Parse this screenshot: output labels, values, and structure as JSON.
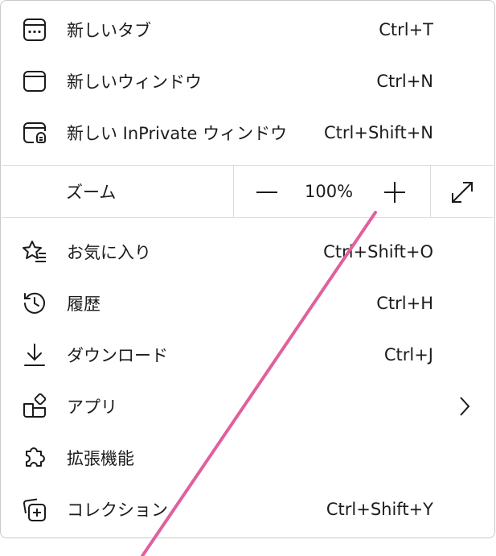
{
  "menu": {
    "items_top": [
      {
        "label": "新しいタブ",
        "shortcut": "Ctrl+T",
        "icon": "new-tab-icon"
      },
      {
        "label": "新しいウィンドウ",
        "shortcut": "Ctrl+N",
        "icon": "new-window-icon"
      },
      {
        "label": "新しい InPrivate ウィンドウ",
        "shortcut": "Ctrl+Shift+N",
        "icon": "inprivate-window-icon"
      }
    ],
    "zoom": {
      "label": "ズーム",
      "value": "100%"
    },
    "items_bottom": [
      {
        "label": "お気に入り",
        "shortcut": "Ctrl+Shift+O",
        "icon": "favorites-star-icon"
      },
      {
        "label": "履歴",
        "shortcut": "Ctrl+H",
        "icon": "history-clock-icon"
      },
      {
        "label": "ダウンロード",
        "shortcut": "Ctrl+J",
        "icon": "download-arrow-icon"
      },
      {
        "label": "アプリ",
        "shortcut": "",
        "icon": "apps-grid-icon"
      },
      {
        "label": "拡張機能",
        "shortcut": "",
        "icon": "extensions-puzzle-icon"
      },
      {
        "label": "コレクション",
        "shortcut": "Ctrl+Shift+Y",
        "icon": "collections-icon"
      }
    ]
  },
  "colors": {
    "text": "#1b1b1b",
    "border": "#c9c9c9",
    "divider": "#dcdcdc",
    "annotation_line": "#e0609e"
  }
}
